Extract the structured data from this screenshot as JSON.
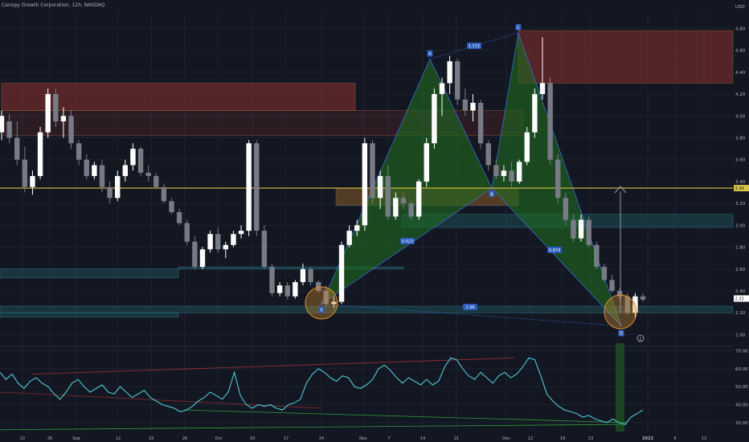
{
  "header": {
    "symbol": "Canopy Growth Corporation, 12h, NASDAQ",
    "currency": "USD"
  },
  "colors": {
    "background": "#131722",
    "grid": "#1e2230",
    "bull_candle": "#ffffff",
    "bear_candle": "#787b86",
    "harmonic_fill": "#1f6b1f",
    "harmonic_line": "#3a6ad0",
    "resistance_zone": "#6b2a2c",
    "support_zone": "#1d4e56",
    "level_line": "#d6c244",
    "rsi_line": "#4cc9d4",
    "price_badge": "#2962ff"
  },
  "chart_data": [
    {
      "type": "candlestick",
      "title": "",
      "x_ticks": [
        "22",
        "26",
        "Sep",
        "12",
        "19",
        "26",
        "Oct",
        "10",
        "17",
        "24",
        "Nov",
        "7",
        "14",
        "21",
        "Dec",
        "12",
        "19",
        "23",
        "2023",
        "9",
        "13"
      ],
      "y_ticks": [
        4.8,
        4.6,
        4.4,
        4.2,
        4.0,
        3.8,
        3.6,
        3.4,
        3.2,
        3.0,
        2.8,
        2.6,
        2.4,
        2.2,
        2.0
      ],
      "ylim": [
        1.9,
        4.95
      ],
      "ohlc_fields": [
        "open",
        "high",
        "low",
        "close"
      ],
      "candles": [
        [
          3.85,
          4.05,
          3.78,
          4.0
        ],
        [
          3.95,
          4.02,
          3.75,
          3.8
        ],
        [
          3.8,
          3.95,
          3.55,
          3.6
        ],
        [
          3.6,
          3.72,
          3.3,
          3.35
        ],
        [
          3.35,
          3.5,
          3.28,
          3.45
        ],
        [
          3.45,
          3.9,
          3.42,
          3.85
        ],
        [
          3.85,
          4.25,
          3.8,
          4.2
        ],
        [
          4.2,
          4.25,
          3.9,
          3.95
        ],
        [
          3.95,
          4.08,
          3.8,
          4.0
        ],
        [
          4.0,
          4.05,
          3.7,
          3.75
        ],
        [
          3.75,
          3.78,
          3.55,
          3.6
        ],
        [
          3.6,
          3.65,
          3.42,
          3.45
        ],
        [
          3.45,
          3.58,
          3.42,
          3.55
        ],
        [
          3.55,
          3.6,
          3.3,
          3.35
        ],
        [
          3.35,
          3.4,
          3.2,
          3.25
        ],
        [
          3.25,
          3.5,
          3.22,
          3.45
        ],
        [
          3.45,
          3.6,
          3.4,
          3.55
        ],
        [
          3.55,
          3.75,
          3.5,
          3.7
        ],
        [
          3.7,
          3.72,
          3.45,
          3.48
        ],
        [
          3.48,
          3.55,
          3.4,
          3.45
        ],
        [
          3.45,
          3.48,
          3.33,
          3.35
        ],
        [
          3.35,
          3.38,
          3.2,
          3.22
        ],
        [
          3.22,
          3.25,
          3.1,
          3.12
        ],
        [
          3.12,
          3.15,
          3.0,
          3.02
        ],
        [
          3.02,
          3.05,
          2.82,
          2.85
        ],
        [
          2.85,
          2.9,
          2.6,
          2.62
        ],
        [
          2.62,
          2.8,
          2.6,
          2.78
        ],
        [
          2.78,
          2.95,
          2.75,
          2.92
        ],
        [
          2.92,
          2.98,
          2.75,
          2.78
        ],
        [
          2.78,
          2.85,
          2.7,
          2.82
        ],
        [
          2.82,
          2.95,
          2.8,
          2.92
        ],
        [
          2.92,
          3.0,
          2.88,
          2.95
        ],
        [
          2.95,
          3.78,
          2.9,
          3.75
        ],
        [
          3.75,
          3.78,
          2.9,
          2.95
        ],
        [
          2.95,
          3.0,
          2.6,
          2.62
        ],
        [
          2.62,
          2.65,
          2.35,
          2.38
        ],
        [
          2.38,
          2.48,
          2.35,
          2.45
        ],
        [
          2.45,
          2.48,
          2.32,
          2.35
        ],
        [
          2.35,
          2.5,
          2.33,
          2.48
        ],
        [
          2.48,
          2.65,
          2.45,
          2.6
        ],
        [
          2.6,
          2.62,
          2.45,
          2.48
        ],
        [
          2.48,
          2.5,
          2.38,
          2.4
        ],
        [
          2.4,
          2.45,
          2.25,
          2.28
        ],
        [
          2.28,
          2.35,
          2.24,
          2.3
        ],
        [
          2.3,
          2.85,
          2.28,
          2.82
        ],
        [
          2.82,
          3.0,
          2.8,
          2.95
        ],
        [
          2.95,
          3.05,
          2.9,
          3.0
        ],
        [
          3.0,
          3.8,
          2.95,
          3.75
        ],
        [
          3.75,
          3.78,
          3.2,
          3.25
        ],
        [
          3.25,
          3.5,
          3.15,
          3.45
        ],
        [
          3.45,
          3.55,
          3.05,
          3.08
        ],
        [
          3.08,
          3.3,
          3.05,
          3.25
        ],
        [
          3.25,
          3.3,
          3.15,
          3.2
        ],
        [
          3.2,
          3.22,
          3.05,
          3.08
        ],
        [
          3.08,
          3.42,
          3.05,
          3.4
        ],
        [
          3.4,
          3.8,
          3.35,
          3.75
        ],
        [
          3.75,
          4.25,
          3.7,
          4.2
        ],
        [
          4.2,
          4.35,
          4.0,
          4.3
        ],
        [
          4.3,
          4.55,
          4.2,
          4.5
        ],
        [
          4.5,
          4.52,
          4.1,
          4.15
        ],
        [
          4.15,
          4.25,
          4.0,
          4.05
        ],
        [
          4.05,
          4.2,
          3.95,
          4.12
        ],
        [
          4.12,
          4.15,
          3.7,
          3.75
        ],
        [
          3.75,
          3.78,
          3.5,
          3.55
        ],
        [
          3.55,
          3.6,
          3.42,
          3.45
        ],
        [
          3.45,
          3.55,
          3.4,
          3.5
        ],
        [
          3.5,
          3.58,
          3.35,
          3.4
        ],
        [
          3.4,
          3.6,
          3.38,
          3.58
        ],
        [
          3.58,
          3.9,
          3.55,
          3.85
        ],
        [
          3.85,
          4.25,
          3.8,
          4.2
        ],
        [
          4.2,
          4.72,
          4.15,
          4.3
        ],
        [
          4.3,
          4.35,
          3.55,
          3.6
        ],
        [
          3.6,
          3.65,
          3.2,
          3.25
        ],
        [
          3.25,
          3.3,
          3.0,
          3.05
        ],
        [
          3.05,
          3.1,
          2.85,
          2.88
        ],
        [
          2.88,
          3.1,
          2.85,
          3.05
        ],
        [
          3.05,
          3.08,
          2.8,
          2.82
        ],
        [
          2.82,
          2.85,
          2.6,
          2.62
        ],
        [
          2.62,
          2.65,
          2.48,
          2.5
        ],
        [
          2.5,
          2.55,
          2.38,
          2.4
        ],
        [
          2.4,
          2.42,
          2.32,
          2.35
        ],
        [
          2.35,
          2.38,
          2.18,
          2.2
        ],
        [
          2.2,
          2.38,
          2.15,
          2.35
        ],
        [
          2.35,
          2.38,
          2.3,
          2.32
        ]
      ],
      "current_price": 2.33,
      "current_price_label": "2.33",
      "level_label": "3.34",
      "levels": [
        {
          "kind": "resistance",
          "from": 4.05,
          "to": 4.3
        },
        {
          "kind": "resistance",
          "from": 4.3,
          "to": 4.78
        },
        {
          "kind": "resistance",
          "from": 3.82,
          "to": 4.05
        },
        {
          "kind": "pattern-zone",
          "from": 3.18,
          "to": 3.34
        },
        {
          "kind": "support",
          "from": 2.98,
          "to": 3.1
        },
        {
          "kind": "support",
          "from": 2.6,
          "to": 2.62
        },
        {
          "kind": "support",
          "from": 2.52,
          "to": 2.6
        },
        {
          "kind": "support",
          "from": 2.2,
          "to": 2.26
        },
        {
          "kind": "support",
          "from": 2.16,
          "to": 2.2
        }
      ],
      "key_level": 3.34,
      "harmonic_points": [
        {
          "label": "X",
          "price": 2.28
        },
        {
          "label": "A",
          "price": 4.52
        },
        {
          "label": "B",
          "price": 3.34
        },
        {
          "label": "C",
          "price": 4.76
        },
        {
          "label": "D",
          "price": 2.08
        }
      ],
      "ratio_labels": [
        "0.523",
        "1.172",
        "0.874",
        "1.06"
      ],
      "target_price": 3.34
    },
    {
      "type": "line",
      "title": "",
      "y_ticks": [
        70.0,
        60.0,
        50.0,
        40.0,
        30.0
      ],
      "ylim": [
        25,
        72
      ],
      "values": [
        58,
        54,
        57,
        52,
        49,
        53,
        55,
        52,
        50,
        46,
        43,
        47,
        52,
        54,
        50,
        47,
        49,
        51,
        47,
        46,
        50,
        47,
        44,
        46,
        48,
        44,
        42,
        40,
        39,
        38,
        36,
        37,
        39,
        42,
        44,
        47,
        45,
        43,
        47,
        58,
        45,
        40,
        38,
        40,
        39,
        40,
        38,
        37,
        40,
        41,
        43,
        52,
        57,
        60,
        58,
        55,
        53,
        56,
        55,
        50,
        49,
        51,
        54,
        60,
        62,
        59,
        55,
        52,
        55,
        53,
        51,
        54,
        51,
        53,
        61,
        66,
        65,
        60,
        56,
        54,
        58,
        55,
        52,
        56,
        58,
        55,
        57,
        61,
        66,
        65,
        56,
        46,
        42,
        39,
        37,
        36,
        35,
        33,
        34,
        32,
        31,
        30,
        32,
        30,
        29,
        33,
        35,
        37
      ]
    }
  ]
}
